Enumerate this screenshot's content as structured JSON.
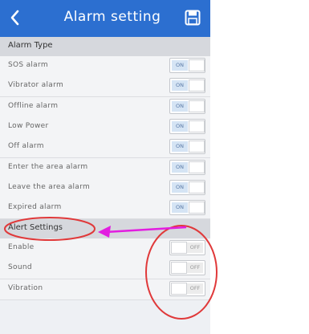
{
  "header": {
    "title": "Alarm setting",
    "back_icon": "chevron-left-icon",
    "save_icon": "save-icon",
    "color": "#2c6fd0"
  },
  "alarm_type": {
    "title": "Alarm Type",
    "items": [
      {
        "label": "SOS alarm",
        "state": "ON"
      },
      {
        "label": "Vibrator alarm",
        "state": "ON"
      },
      {
        "label": "Offline alarm",
        "state": "ON"
      },
      {
        "label": "Low Power",
        "state": "ON"
      },
      {
        "label": "Off alarm",
        "state": "ON"
      },
      {
        "label": "Enter the area alarm",
        "state": "ON"
      },
      {
        "label": "Leave the area alarm",
        "state": "ON"
      },
      {
        "label": "Expired alarm",
        "state": "ON"
      }
    ]
  },
  "alert_settings": {
    "title": "Alert Settings",
    "items": [
      {
        "label": "Enable",
        "state": "OFF"
      },
      {
        "label": "Sound",
        "state": "OFF"
      },
      {
        "label": "Vibration",
        "state": "OFF"
      }
    ]
  },
  "annotation_colors": {
    "circle": "#e0393a",
    "arrow": "#e21ee0"
  }
}
